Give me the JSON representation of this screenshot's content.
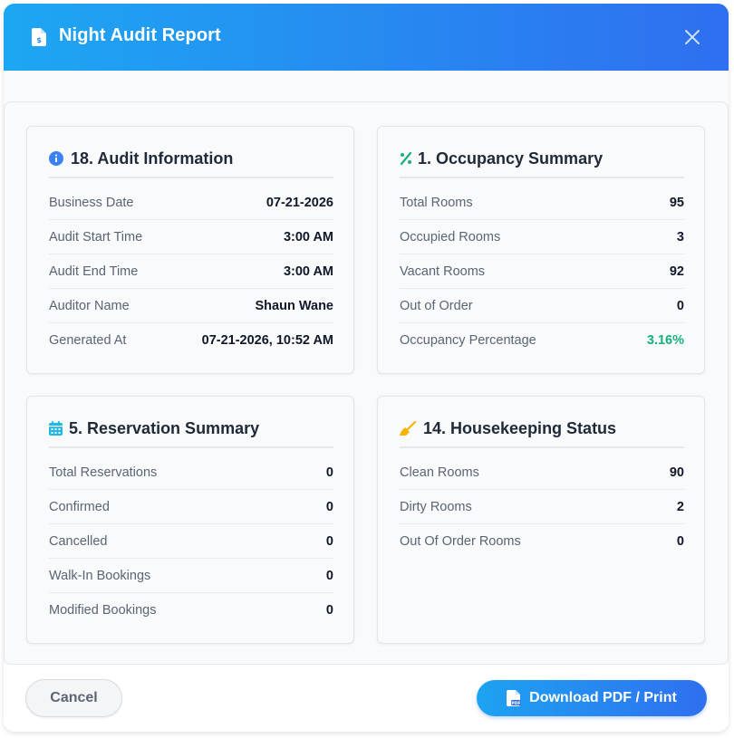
{
  "header": {
    "title": "Night Audit Report",
    "icon": "file-invoice-icon",
    "close_icon": "close-icon"
  },
  "colors": {
    "header_gradient_start": "#1da7f2",
    "header_gradient_end": "#2f6ff0",
    "green_accent": "#16b07a",
    "audit_icon": "#3b82f6",
    "occupancy_icon": "#16b07a",
    "reservation_icon": "#22b8e6",
    "housekeeping_icon": "#f5b400"
  },
  "cards": {
    "audit": {
      "title": "18. Audit Information",
      "icon": "info-circle-icon",
      "rows": [
        {
          "label": "Business Date",
          "value": "07-21-2026"
        },
        {
          "label": "Audit Start Time",
          "value": "3:00 AM"
        },
        {
          "label": "Audit End Time",
          "value": "3:00 AM"
        },
        {
          "label": "Auditor Name",
          "value": "Shaun Wane"
        },
        {
          "label": "Generated At",
          "value": "07-21-2026, 10:52 AM"
        }
      ]
    },
    "occupancy": {
      "title": "1. Occupancy Summary",
      "icon": "percent-icon",
      "rows": [
        {
          "label": "Total Rooms",
          "value": "95"
        },
        {
          "label": "Occupied Rooms",
          "value": "3"
        },
        {
          "label": "Vacant Rooms",
          "value": "92"
        },
        {
          "label": "Out of Order",
          "value": "0"
        },
        {
          "label": "Occupancy Percentage",
          "value": "3.16%"
        }
      ]
    },
    "reservation": {
      "title": "5. Reservation Summary",
      "icon": "calendar-icon",
      "rows": [
        {
          "label": "Total Reservations",
          "value": "0"
        },
        {
          "label": "Confirmed",
          "value": "0"
        },
        {
          "label": "Cancelled",
          "value": "0"
        },
        {
          "label": "Walk-In Bookings",
          "value": "0"
        },
        {
          "label": "Modified Bookings",
          "value": "0"
        }
      ]
    },
    "housekeeping": {
      "title": "14. Housekeeping Status",
      "icon": "broom-icon",
      "rows": [
        {
          "label": "Clean Rooms",
          "value": "90"
        },
        {
          "label": "Dirty Rooms",
          "value": "2"
        },
        {
          "label": "Out Of Order Rooms",
          "value": "0"
        }
      ]
    }
  },
  "footer": {
    "cancel_label": "Cancel",
    "download_label": "Download PDF / Print",
    "download_icon": "file-pdf-icon"
  }
}
